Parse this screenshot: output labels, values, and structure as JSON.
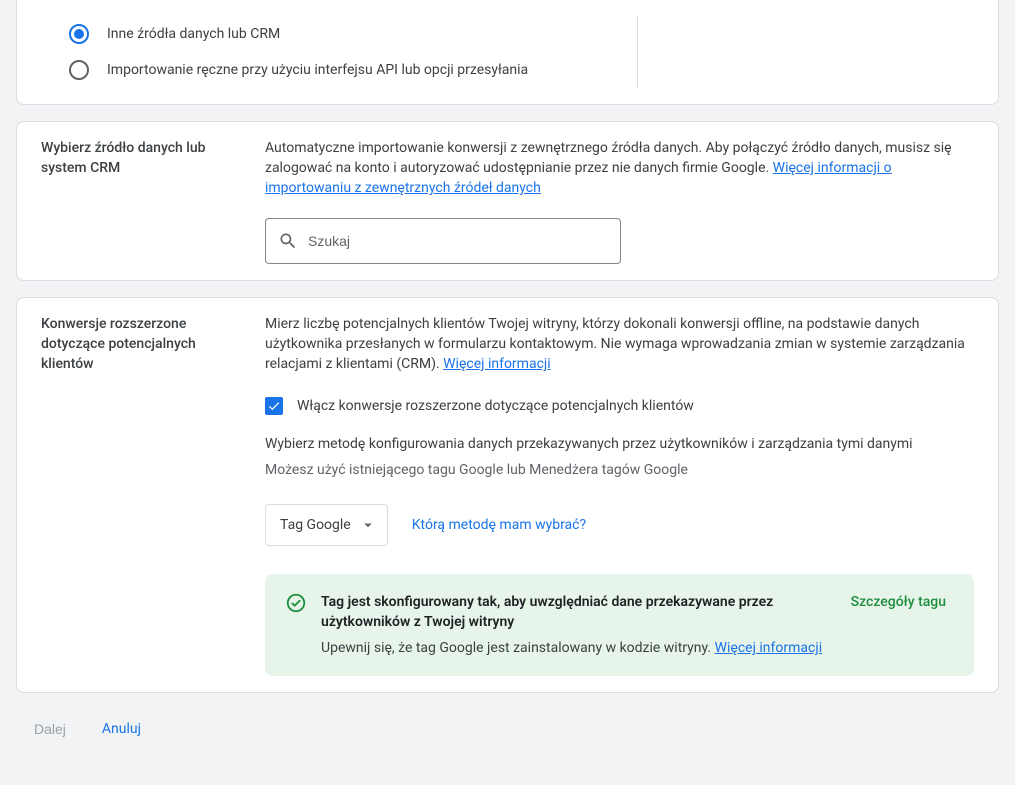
{
  "radios": {
    "option1": "Inne źródła danych lub CRM",
    "option2": "Importowanie ręczne przy użyciu interfejsu API lub opcji przesyłania"
  },
  "section1": {
    "title": "Wybierz źródło danych lub system CRM",
    "desc": "Automatyczne importowanie konwersji z zewnętrznego źródła danych. Aby połączyć źródło danych, musisz się zalogować na konto i autoryzować udostępnianie przez nie danych firmie Google. ",
    "link": "Więcej informacji o importowaniu z zewnętrznych źródeł danych",
    "search_placeholder": "Szukaj"
  },
  "section2": {
    "title": "Konwersje rozszerzone dotyczące potencjalnych klientów",
    "desc": "Mierz liczbę potencjalnych klientów Twojej witryny, którzy dokonali konwersji offline, na podstawie danych użytkownika przesłanych w formularzu kontaktowym. Nie wymaga wprowadzania zmian w systemie zarządzania relacjami z klientami (CRM). ",
    "link": "Więcej informacji",
    "checkbox_label": "Włącz konwersje rozszerzone dotyczące potencjalnych klientów",
    "method_label": "Wybierz metodę konfigurowania danych przekazywanych przez użytkowników i zarządzania tymi danymi",
    "method_sub": "Możesz użyć istniejącego tagu Google lub Menedżera tagów Google",
    "select_value": "Tag Google",
    "select_help": "Którą metodę mam wybrać?",
    "status_title": "Tag jest skonfigurowany tak, aby uwzględniać dane przekazywane przez użytkowników z Twojej witryny",
    "status_sub": "Upewnij się, że tag Google jest zainstalowany w kodzie witryny. ",
    "status_sub_link": "Więcej informacji",
    "status_details": "Szczegóły tagu"
  },
  "footer": {
    "next": "Dalej",
    "cancel": "Anuluj"
  }
}
